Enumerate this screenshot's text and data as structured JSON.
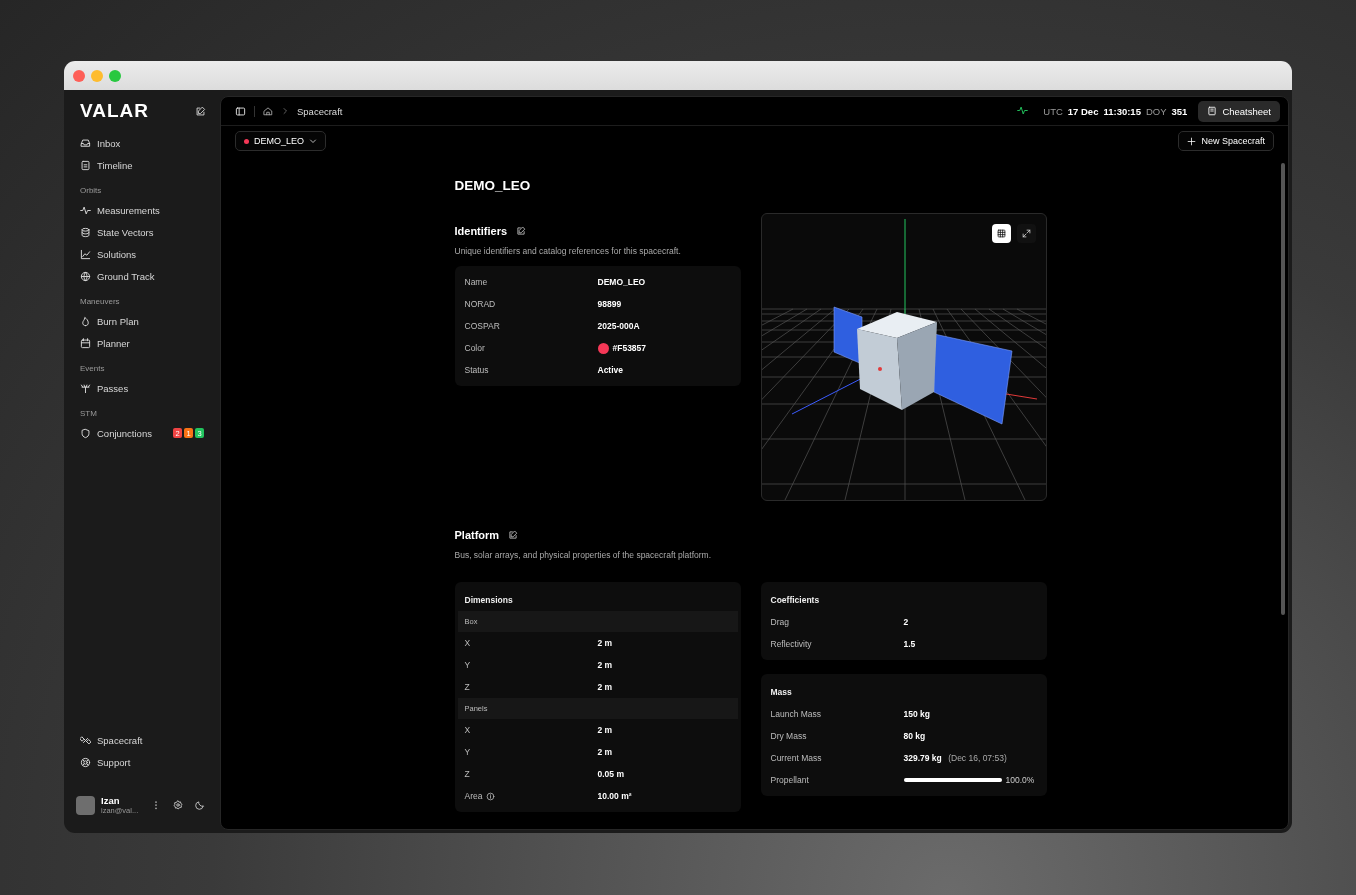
{
  "sidebar": {
    "brand": "VALAR",
    "groups": [
      {
        "items": [
          {
            "label": "Inbox"
          },
          {
            "label": "Timeline"
          }
        ]
      },
      {
        "heading": "Orbits",
        "items": [
          {
            "label": "Measurements"
          },
          {
            "label": "State Vectors"
          },
          {
            "label": "Solutions"
          },
          {
            "label": "Ground Track"
          }
        ]
      },
      {
        "heading": "Maneuvers",
        "items": [
          {
            "label": "Burn Plan"
          },
          {
            "label": "Planner"
          }
        ]
      },
      {
        "heading": "Events",
        "items": [
          {
            "label": "Passes"
          }
        ]
      },
      {
        "heading": "STM",
        "items": [
          {
            "label": "Conjunctions",
            "badges": [
              {
                "text": "2",
                "color": "#ef4444"
              },
              {
                "text": "1",
                "color": "#f97316"
              },
              {
                "text": "3",
                "color": "#22c55e"
              }
            ]
          }
        ]
      }
    ],
    "footer_items": [
      {
        "label": "Spacecraft"
      },
      {
        "label": "Support"
      }
    ],
    "user": {
      "name": "Izan",
      "email": "izan@val..."
    }
  },
  "topbar": {
    "breadcrumb": "Spacecraft",
    "utc_label": "UTC",
    "date": "17 Dec",
    "time": "11:30:15",
    "doy_label": "DOY",
    "doy": "351",
    "cheatsheet_button": "Cheatsheet"
  },
  "toolbar": {
    "spacecraft_selector": {
      "label": "DEMO_LEO",
      "color": "#F53857"
    },
    "new_button": "New Spacecraft"
  },
  "page_title": "DEMO_LEO",
  "identifiers": {
    "title": "Identifiers",
    "description": "Unique identifiers and catalog references for this spacecraft.",
    "rows": [
      {
        "label": "Name",
        "value": "DEMO_LEO"
      },
      {
        "label": "NORAD",
        "value": "98899"
      },
      {
        "label": "COSPAR",
        "value": "2025-000A"
      },
      {
        "label": "Color",
        "value": "#F53857",
        "color": "#F53857"
      },
      {
        "label": "Status",
        "value": "Active"
      }
    ]
  },
  "viewer": {
    "buttons": [
      {
        "kind": "grid",
        "selected": true
      },
      {
        "kind": "expand",
        "selected": false
      }
    ]
  },
  "platform": {
    "title": "Platform",
    "description": "Bus, solar arrays, and physical properties of the spacecraft platform.",
    "dimensions": {
      "title": "Dimensions",
      "groups": [
        {
          "title": "Box",
          "rows": [
            {
              "label": "X",
              "value": "2 m"
            },
            {
              "label": "Y",
              "value": "2 m"
            },
            {
              "label": "Z",
              "value": "2 m"
            }
          ]
        },
        {
          "title": "Panels",
          "rows": [
            {
              "label": "X",
              "value": "2 m"
            },
            {
              "label": "Y",
              "value": "2 m"
            },
            {
              "label": "Z",
              "value": "0.05 m"
            },
            {
              "label": "Area",
              "value": "10.00 m²",
              "info": true
            }
          ]
        }
      ]
    },
    "coefficients": {
      "title": "Coefficients",
      "rows": [
        {
          "label": "Drag",
          "value": "2"
        },
        {
          "label": "Reflectivity",
          "value": "1.5"
        }
      ]
    },
    "mass": {
      "title": "Mass",
      "rows": [
        {
          "label": "Launch Mass",
          "value": "150 kg"
        },
        {
          "label": "Dry Mass",
          "value": "80 kg"
        },
        {
          "label": "Current Mass",
          "value": "329.79 kg",
          "note": "(Dec 16, 07:53)"
        }
      ],
      "propellant": {
        "label": "Propellant",
        "level": 1.0,
        "reading": "100.0%"
      }
    }
  }
}
